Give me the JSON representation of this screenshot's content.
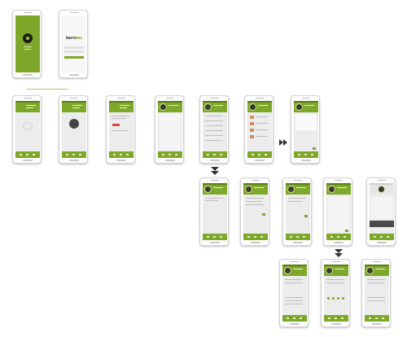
{
  "diagram": {
    "splash": {
      "brand_text": "",
      "logo_icon": "owl-logo-icon"
    },
    "login": {
      "brand_prefix": "barro",
      "brand_suffix": "tas"
    },
    "colors": {
      "accent": "#7ea82a",
      "accent_dark": "#5c7d17",
      "frame": "#d4d4d4",
      "screen_bg": "#ececec"
    },
    "flow": {
      "rows": 4,
      "screens_per_row": [
        2,
        7,
        5,
        3
      ],
      "arrows": [
        "right",
        "down",
        "down"
      ]
    }
  }
}
